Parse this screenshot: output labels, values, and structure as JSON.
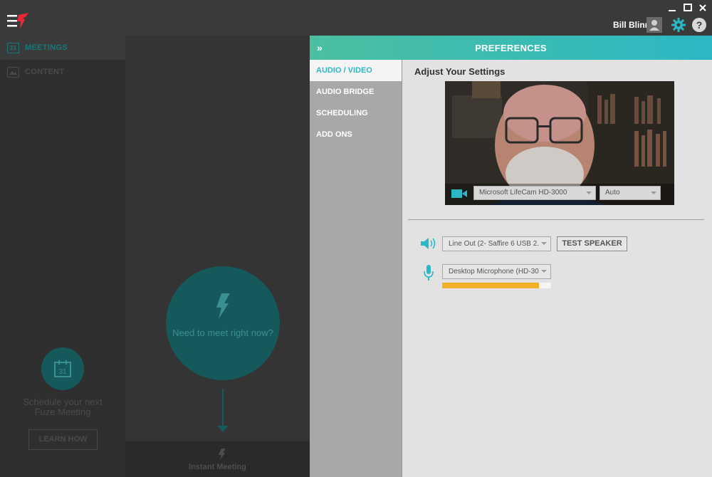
{
  "header": {
    "user_name": "Bill Blinn",
    "icons": [
      "fuze-logo-icon",
      "user-avatar-icon",
      "gear-icon",
      "help-icon",
      "minimize-icon",
      "maximize-icon",
      "close-icon"
    ],
    "help_glyph": "?"
  },
  "leftnav": {
    "items": [
      {
        "label": "MEETINGS",
        "icon": "calendar-icon",
        "icon_text": "31"
      },
      {
        "label": "CONTENT",
        "icon": "image-icon",
        "icon_text": ""
      }
    ],
    "schedule_text": "Schedule your next Fuze Meeting",
    "calendar_number": "31",
    "learn_button": "LEARN HOW"
  },
  "middle": {
    "circle_text": "Need to meet right now?",
    "instant_label": "Instant Meeting"
  },
  "preferences": {
    "title": "PREFERENCES",
    "collapse_glyph": "»",
    "tabs": [
      "AUDIO / VIDEO",
      "AUDIO BRIDGE",
      "SCHEDULING",
      "ADD ONS"
    ],
    "active_tab": "AUDIO / VIDEO",
    "settings_title": "Adjust Your Settings",
    "camera_select": "Microsoft LifeCam HD-3000",
    "resolution_select": "Auto",
    "speaker_select": "Line Out (2- Saffire 6 USB 2.",
    "test_speaker": "TEST SPEAKER",
    "mic_select": "Desktop Microphone (HD-30",
    "mic_level_percent": 89
  },
  "colors": {
    "accent": "#2bb8c4",
    "teal_dark": "#15595b",
    "level": "#f0b129",
    "logo_red": "#e8283a"
  }
}
